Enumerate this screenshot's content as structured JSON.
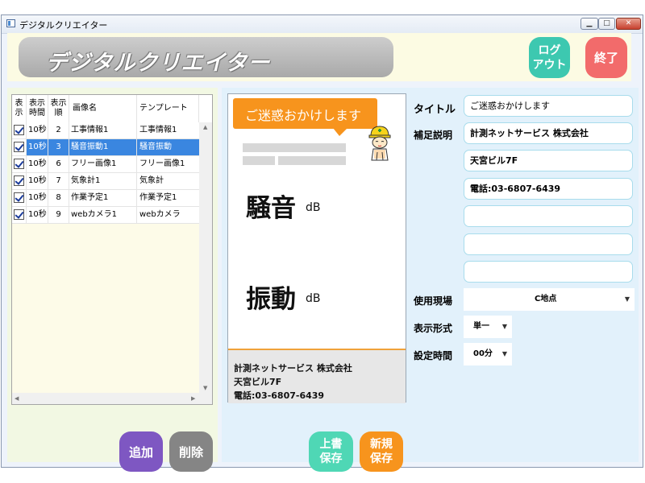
{
  "window": {
    "title": "デジタルクリエイター",
    "min_glyph": "▁",
    "max_glyph": "□",
    "close_glyph": "✕"
  },
  "header": {
    "banner_title": "デジタルクリエイター",
    "logout_line1": "ログ",
    "logout_line2": "アウト",
    "exit_label": "終了"
  },
  "list": {
    "headers": {
      "show": "表示",
      "time": "表示時間",
      "order": "表示順",
      "image": "画像名",
      "template": "テンプレート"
    },
    "rows": [
      {
        "checked": true,
        "time": "10秒",
        "order": "2",
        "image": "工事情報1",
        "template": "工事情報1",
        "selected": false
      },
      {
        "checked": true,
        "time": "10秒",
        "order": "3",
        "image": "騒音振動1",
        "template": "騒音振動",
        "selected": true
      },
      {
        "checked": true,
        "time": "10秒",
        "order": "6",
        "image": "フリー画像1",
        "template": "フリー画像1",
        "selected": false
      },
      {
        "checked": true,
        "time": "10秒",
        "order": "7",
        "image": "気象計1",
        "template": "気象計",
        "selected": false
      },
      {
        "checked": true,
        "time": "10秒",
        "order": "8",
        "image": "作業予定1",
        "template": "作業予定1",
        "selected": false
      },
      {
        "checked": true,
        "time": "10秒",
        "order": "9",
        "image": "webカメラ1",
        "template": "webカメラ",
        "selected": false
      }
    ]
  },
  "left_buttons": {
    "add": "追加",
    "delete": "削除"
  },
  "preview": {
    "bubble_text": "ご迷惑おかけします",
    "noise_label": "騒音",
    "noise_unit": "dB",
    "vibration_label": "振動",
    "vibration_unit": "dB",
    "footer": {
      "line1": "計測ネットサービス 株式会社",
      "line2": "天宮ビル7F",
      "line3": "電話:03-6807-6439"
    }
  },
  "save_buttons": {
    "overwrite_line1": "上書",
    "overwrite_line2": "保存",
    "new_line1": "新規",
    "new_line2": "保存"
  },
  "form": {
    "title_label": "タイトル",
    "title_value": "ご迷惑おかけします",
    "supplement_label": "補足説明",
    "supplement_lines": [
      "計測ネットサービス 株式会社",
      "天宮ビル7F",
      "電話:03-6807-6439",
      "",
      "",
      ""
    ],
    "site_label": "使用現場",
    "site_value": "C地点",
    "format_label": "表示形式",
    "format_value": "単一",
    "time_label": "設定時間",
    "time_value": "00分"
  },
  "colors": {
    "selected_row": "#3a86e0",
    "logout": "#3dc8b0",
    "exit": "#f26b6b",
    "add": "#7e57c2",
    "delete": "#858585",
    "overwrite": "#4fd7b5",
    "new_save": "#f7941d",
    "header_bg": "#fcfbe3"
  }
}
